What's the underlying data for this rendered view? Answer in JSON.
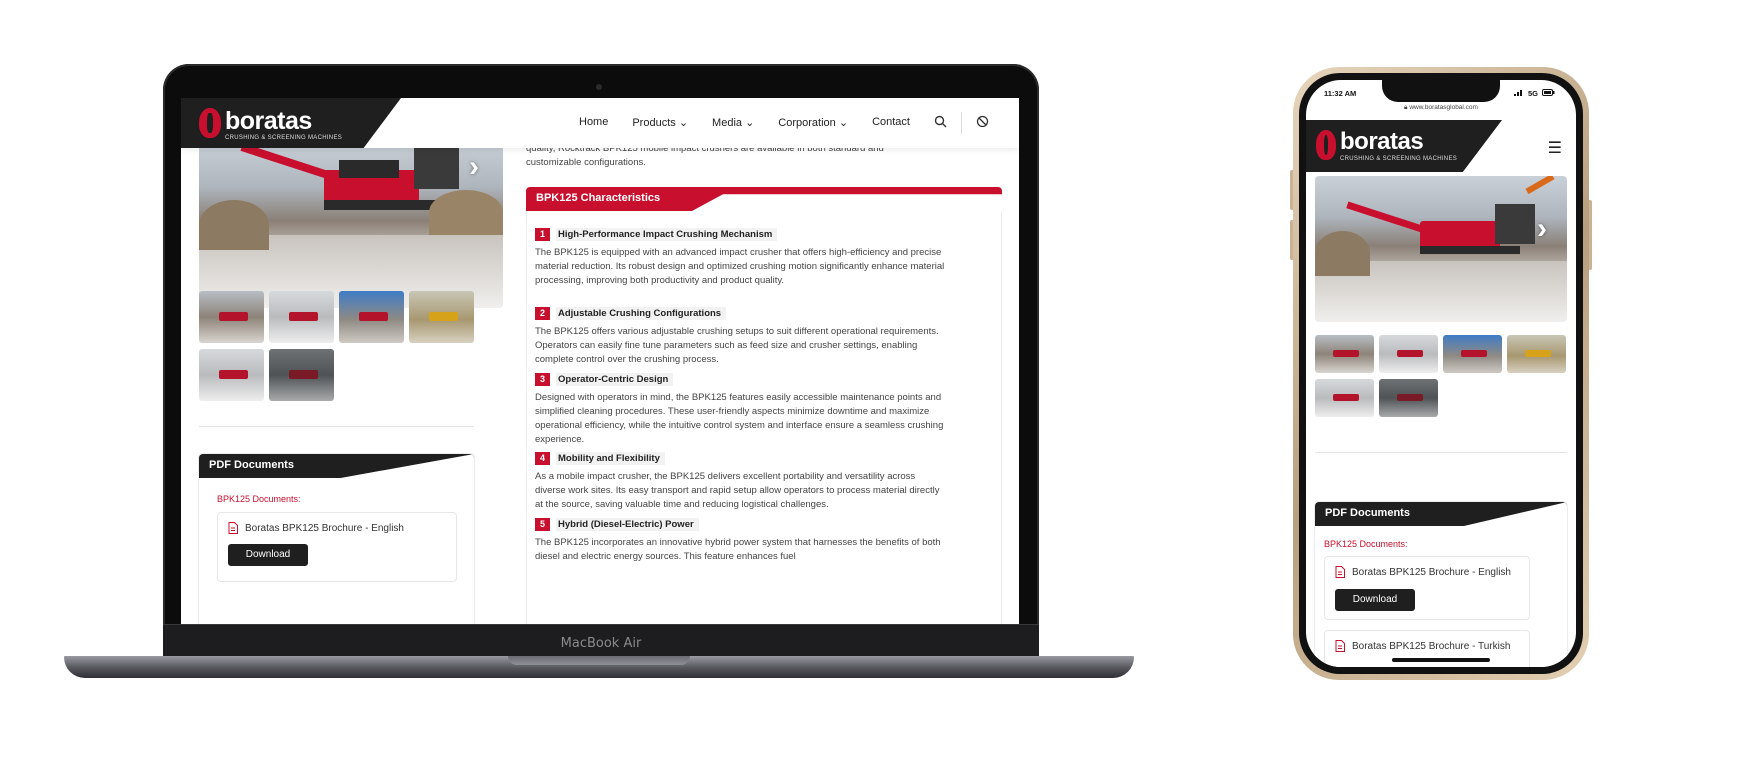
{
  "device_label": "MacBook Air",
  "brand": {
    "name": "boratas",
    "tagline": "CRUSHING & SCREENING MACHINES",
    "accent": "#c8102e",
    "dark": "#1f1f1f"
  },
  "nav": {
    "items": [
      "Home",
      "Products",
      "Media",
      "Corporation",
      "Contact"
    ],
    "chevron": "⌄",
    "search_icon": "search-icon",
    "language_icon": "globe-icon"
  },
  "intro_text": "quality, Rocktrack BPK125 mobile impact crushers are available in both standard and customizable configurations.",
  "characteristics": {
    "title": "BPK125 Characteristics",
    "features": [
      {
        "num": "1",
        "title": "High-Performance Impact Crushing Mechanism",
        "desc": "The BPK125 is equipped with an advanced impact crusher that offers high-efficiency and precise material reduction. Its robust design and optimized crushing motion significantly enhance material processing, improving both productivity and product quality."
      },
      {
        "num": "2",
        "title": "Adjustable Crushing Configurations",
        "desc": "The BPK125 offers various adjustable crushing setups to suit different operational requirements. Operators can easily fine tune parameters such as feed size and crusher settings, enabling complete control over the crushing process."
      },
      {
        "num": "3",
        "title": "Operator-Centric Design",
        "desc": "Designed with operators in mind, the BPK125 features easily accessible maintenance points and simplified cleaning procedures. These user-friendly aspects minimize downtime and maximize operational efficiency, while the intuitive control system and interface ensure a seamless crushing experience."
      },
      {
        "num": "4",
        "title": "Mobility and Flexibility",
        "desc": "As a mobile impact crusher, the BPK125 delivers excellent portability and versatility across diverse work sites. Its easy transport and rapid setup allow operators to process material directly at the source, saving valuable time and reducing logistical challenges."
      },
      {
        "num": "5",
        "title": "Hybrid (Diesel-Electric) Power",
        "desc": "The BPK125 incorporates an innovative hybrid power system that harnesses the benefits of both diesel and electric energy sources. This feature enhances fuel"
      }
    ]
  },
  "pdf": {
    "title": "PDF Documents",
    "subtitle": "BPK125 Documents:",
    "items": [
      {
        "name": "Boratas BPK125 Brochure - English",
        "button": "Download"
      },
      {
        "name": "Boratas BPK125 Brochure - Turkish"
      }
    ]
  },
  "phone": {
    "time": "11:32 AM",
    "signal": "5G",
    "url": "www.boratasglobal.com",
    "menu_icon": "hamburger-icon"
  },
  "gallery": {
    "next_arrow": "›"
  }
}
